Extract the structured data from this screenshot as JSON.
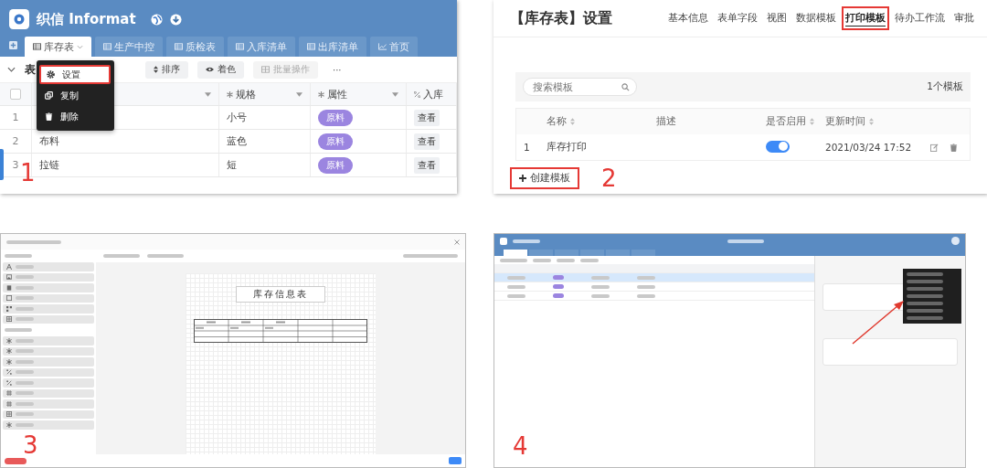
{
  "panel_1": {
    "marker": "1",
    "app_title": "织信 Informat",
    "tabs": [
      {
        "label": "库存表",
        "kind": "grid",
        "selected": true
      },
      {
        "label": "生产中控",
        "kind": "grid",
        "selected": false
      },
      {
        "label": "质检表",
        "kind": "grid",
        "selected": false
      },
      {
        "label": "入库清单",
        "kind": "grid",
        "selected": false
      },
      {
        "label": "出库清单",
        "kind": "grid",
        "selected": false
      },
      {
        "label": "首页",
        "kind": "chart",
        "selected": false
      }
    ],
    "view_label": "表",
    "toolbar": [
      {
        "kind": "sort",
        "label": "排序",
        "disabled": false
      },
      {
        "kind": "color",
        "label": "着色",
        "disabled": false
      },
      {
        "kind": "batch",
        "label": "批量操作",
        "disabled": true
      },
      {
        "kind": "more",
        "label": "···",
        "disabled": false
      }
    ],
    "context_menu": [
      {
        "kind": "settings",
        "label": "设置",
        "annotated": true
      },
      {
        "kind": "copy",
        "label": "复制",
        "annotated": false
      },
      {
        "kind": "delete",
        "label": "删除",
        "annotated": false
      }
    ],
    "select_all": {
      "checked": false
    },
    "columns": [
      {
        "kind": "text"
      },
      {
        "kind": "text",
        "label": "规格"
      },
      {
        "kind": "text",
        "label": "属性"
      },
      {
        "kind": "link",
        "label": "入库"
      }
    ],
    "rows": [
      {
        "index": "1",
        "spec": "小号",
        "tag": "原料",
        "link": "查看"
      },
      {
        "index": "2",
        "name": "布料",
        "spec": "蓝色",
        "tag": "原料",
        "link": "查看"
      },
      {
        "index": "3",
        "name": "拉链",
        "spec": "短",
        "tag": "原料",
        "link": "查看"
      }
    ]
  },
  "panel_2": {
    "marker": "2",
    "title": "【库存表】设置",
    "tabs": [
      {
        "label": "基本信息",
        "selected": false,
        "annotated": false
      },
      {
        "label": "表单字段",
        "selected": false,
        "annotated": false
      },
      {
        "label": "视图",
        "selected": false,
        "annotated": false
      },
      {
        "label": "数据模板",
        "selected": false,
        "annotated": false
      },
      {
        "label": "打印模板",
        "selected": true,
        "annotated": true
      },
      {
        "label": "待办工作流",
        "selected": false,
        "annotated": false
      },
      {
        "label": "审批",
        "selected": false,
        "annotated": false
      }
    ],
    "search": {
      "placeholder": "搜索模板"
    },
    "count": "1个模板",
    "columns": [
      {
        "label": "名称",
        "sortable": true
      },
      {
        "label": "描述",
        "sortable": false
      },
      {
        "label": "是否启用",
        "sortable": true
      },
      {
        "label": "更新时间",
        "sortable": true
      }
    ],
    "templates": [
      {
        "index": "1",
        "name": "库存打印",
        "enabled": true,
        "updated": "2021/03/24 17:52"
      }
    ],
    "create_button": {
      "label": "创建模板",
      "annotated": true
    }
  },
  "panel_3": {
    "marker": "3",
    "document_title": "库存信息表",
    "component_groups": [
      {
        "items": [
          {
            "kind": "text"
          },
          {
            "kind": "image"
          },
          {
            "kind": "rich"
          },
          {
            "kind": "frame"
          },
          {
            "kind": "qr"
          },
          {
            "kind": "grid"
          }
        ]
      },
      {
        "items": [
          {
            "kind": "field"
          },
          {
            "kind": "field"
          },
          {
            "kind": "field"
          },
          {
            "kind": "link"
          },
          {
            "kind": "link"
          },
          {
            "kind": "number"
          },
          {
            "kind": "number"
          },
          {
            "kind": "grid"
          },
          {
            "kind": "field"
          }
        ]
      }
    ]
  },
  "panel_4": {
    "marker": "4",
    "tabs": [
      {
        "selected": true
      },
      {
        "selected": false
      },
      {
        "selected": false
      },
      {
        "selected": false
      },
      {
        "selected": false
      },
      {
        "selected": false
      }
    ],
    "rows": [
      {
        "selected": true
      },
      {
        "selected": false
      },
      {
        "selected": false
      }
    ],
    "menu_open": true
  }
}
